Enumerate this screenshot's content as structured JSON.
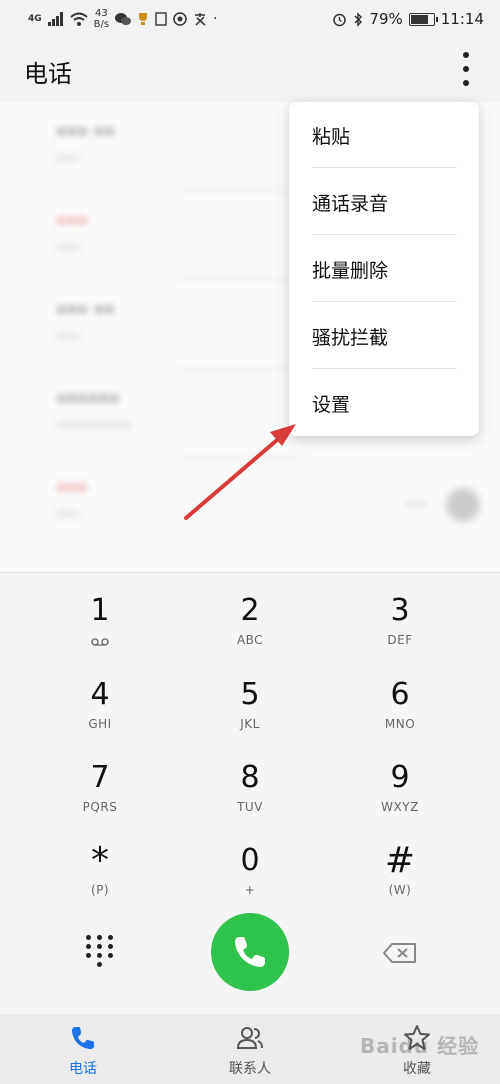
{
  "status_bar": {
    "network": "4G",
    "speed_value": "43",
    "speed_unit": "B/s",
    "battery_percent": "79%",
    "battery_level": 0.79,
    "time": "11:14"
  },
  "header": {
    "title": "电话"
  },
  "call_log": [
    {
      "name": "••• ••",
      "sub": "•••",
      "missed": false
    },
    {
      "name": "•••",
      "sub": "•••",
      "missed": true
    },
    {
      "name": "••• ••",
      "sub": "•••",
      "missed": false
    },
    {
      "name": "••••••",
      "sub": "••••••••••",
      "missed": false
    },
    {
      "name": "•••",
      "sub": "•••",
      "missed": true
    }
  ],
  "menu": {
    "items": [
      {
        "label": "粘贴"
      },
      {
        "label": "通话录音"
      },
      {
        "label": "批量删除"
      },
      {
        "label": "骚扰拦截"
      },
      {
        "label": "设置"
      }
    ]
  },
  "dialpad": {
    "keys": [
      {
        "digit": "1",
        "letters": ""
      },
      {
        "digit": "2",
        "letters": "ABC"
      },
      {
        "digit": "3",
        "letters": "DEF"
      },
      {
        "digit": "4",
        "letters": "GHI"
      },
      {
        "digit": "5",
        "letters": "JKL"
      },
      {
        "digit": "6",
        "letters": "MNO"
      },
      {
        "digit": "7",
        "letters": "PQRS"
      },
      {
        "digit": "8",
        "letters": "TUV"
      },
      {
        "digit": "9",
        "letters": "WXYZ"
      },
      {
        "digit": "*",
        "letters": "(P)"
      },
      {
        "digit": "0",
        "letters": "+"
      },
      {
        "digit": "#",
        "letters": "(W)"
      }
    ]
  },
  "bottom_nav": {
    "items": [
      {
        "label": "电话",
        "icon": "phone-icon",
        "active": true
      },
      {
        "label": "联系人",
        "icon": "contacts-icon",
        "active": false
      },
      {
        "label": "收藏",
        "icon": "star-icon",
        "active": false
      }
    ]
  },
  "watermark": "Baidu 经验",
  "colors": {
    "call_button": "#2fc34c",
    "accent": "#1a73e8",
    "missed": "#e04040",
    "annotation_arrow": "#d93a3a"
  }
}
